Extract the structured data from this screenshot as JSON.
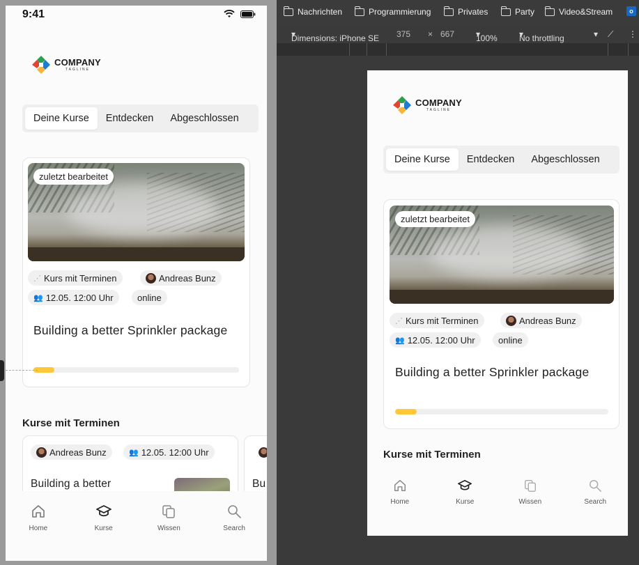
{
  "status": {
    "time": "9:41"
  },
  "logo": {
    "name": "COMPANY",
    "tagline": "TAGLINE"
  },
  "tabs": [
    "Deine Kurse",
    "Entdecken",
    "Abgeschlossen"
  ],
  "course": {
    "badge": "zuletzt bearbeitet",
    "type": "Kurs mit Terminen",
    "author": "Andreas Bunz",
    "date": "12.05. 12:00 Uhr",
    "mode": "online",
    "title": "Building a better Sprinkler package",
    "progress_percent": 10
  },
  "section_title": "Kurse mit Terminen",
  "scheduled": {
    "author": "Andreas Bunz",
    "date": "12.05. 12:00 Uhr",
    "title": "Building a better Sprinkler package",
    "next_title_start": "Bu"
  },
  "nav": [
    {
      "label": "Home",
      "icon": "home-icon"
    },
    {
      "label": "Kurse",
      "icon": "graduation-cap-icon"
    },
    {
      "label": "Wissen",
      "icon": "copy-icon"
    },
    {
      "label": "Search",
      "icon": "search-icon"
    }
  ],
  "bookmarks": [
    "Nachrichten",
    "Programmierung",
    "Privates",
    "Party",
    "Video&Stream"
  ],
  "devtools": {
    "dimensions": "Dimensions: iPhone SE",
    "width": "375",
    "x": "×",
    "height": "667",
    "zoom": "100%",
    "throttling": "No throttling"
  },
  "colors": {
    "accent": "#ffc73a",
    "chip": "#f0f0f0",
    "surface": "#fbfbfb"
  }
}
